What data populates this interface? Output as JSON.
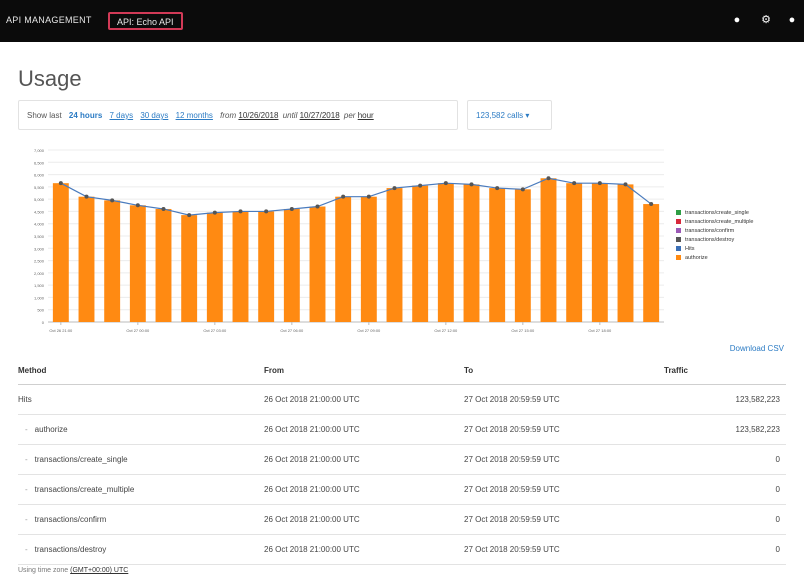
{
  "header": {
    "brand": "API MANAGEMENT",
    "api_chip": "API: Echo API",
    "icons": [
      "help-icon",
      "settings-icon",
      "user-icon"
    ]
  },
  "page": {
    "title": "Usage"
  },
  "filters": {
    "show_last": "Show last",
    "options": [
      "24 hours",
      "7 days",
      "30 days",
      "12 months"
    ],
    "active_option": "24 hours",
    "from_label": "from",
    "from_date": "10/26/2018",
    "until_label": "until",
    "until_date": "10/27/2018",
    "per_label": "per",
    "per_value": "hour",
    "metric_select": "123,582 calls"
  },
  "chart_data": {
    "type": "bar",
    "categories": [
      "Oct 26 21:00",
      "Oct 26 22:00",
      "Oct 26 23:00",
      "Oct 27 00:00",
      "Oct 27 01:00",
      "Oct 27 02:00",
      "Oct 27 03:00",
      "Oct 27 04:00",
      "Oct 27 05:00",
      "Oct 27 06:00",
      "Oct 27 07:00",
      "Oct 27 08:00",
      "Oct 27 09:00",
      "Oct 27 10:00",
      "Oct 27 11:00",
      "Oct 27 12:00",
      "Oct 27 13:00",
      "Oct 27 14:00",
      "Oct 27 15:00",
      "Oct 27 16:00",
      "Oct 27 17:00",
      "Oct 27 18:00",
      "Oct 27 19:00",
      "Oct 27 20:00"
    ],
    "tick_labels": [
      "Oct 26 21:00",
      "Oct 27 00:00",
      "Oct 27 03:00",
      "Oct 27 06:00",
      "Oct 27 09:00",
      "Oct 27 12:00",
      "Oct 27 15:00",
      "Oct 27 18:00"
    ],
    "y_ticks": [
      "0",
      "500",
      "1,000",
      "1,500",
      "2,000",
      "2,500",
      "3,000",
      "3,500",
      "4,000",
      "4,500",
      "5,000",
      "5,500",
      "6,000",
      "6,500",
      "7,000"
    ],
    "ylim": [
      0,
      7000
    ],
    "series": [
      {
        "name": "authorize",
        "color": "#ff8a12",
        "style": "bar",
        "values": [
          5650,
          5100,
          4950,
          4750,
          4600,
          4350,
          4450,
          4500,
          4500,
          4600,
          4700,
          5100,
          5100,
          5450,
          5550,
          5650,
          5600,
          5450,
          5400,
          5850,
          5650,
          5650,
          5600,
          4800
        ]
      },
      {
        "name": "Hits",
        "color": "#4a7bbd",
        "style": "line",
        "values": [
          5650,
          5100,
          4950,
          4750,
          4600,
          4350,
          4450,
          4500,
          4500,
          4600,
          4700,
          5100,
          5100,
          5450,
          5550,
          5650,
          5600,
          5450,
          5400,
          5850,
          5650,
          5650,
          5600,
          4800
        ]
      }
    ],
    "legend": [
      {
        "name": "transactions/create_single",
        "color": "#2e9e45"
      },
      {
        "name": "transactions/create_multiple",
        "color": "#d8283b"
      },
      {
        "name": "transactions/confirm",
        "color": "#9b59b6"
      },
      {
        "name": "transactions/destroy",
        "color": "#555555"
      },
      {
        "name": "Hits",
        "color": "#3b6fb6"
      },
      {
        "name": "authorize",
        "color": "#ff8a12"
      }
    ],
    "legend_position": "right",
    "grid": true
  },
  "download_label": "Download CSV",
  "table": {
    "headers": [
      "Method",
      "From",
      "To",
      "Traffic"
    ],
    "rows": [
      {
        "method": "Hits",
        "indent": false,
        "from": "26 Oct 2018 21:00:00 UTC",
        "to": "27 Oct 2018 20:59:59 UTC",
        "traffic": "123,582,223"
      },
      {
        "method": "authorize",
        "indent": true,
        "from": "26 Oct 2018 21:00:00 UTC",
        "to": "27 Oct 2018 20:59:59 UTC",
        "traffic": "123,582,223"
      },
      {
        "method": "transactions/create_single",
        "indent": true,
        "from": "26 Oct 2018 21:00:00 UTC",
        "to": "27 Oct 2018 20:59:59 UTC",
        "traffic": "0"
      },
      {
        "method": "transactions/create_multiple",
        "indent": true,
        "from": "26 Oct 2018 21:00:00 UTC",
        "to": "27 Oct 2018 20:59:59 UTC",
        "traffic": "0"
      },
      {
        "method": "transactions/confirm",
        "indent": true,
        "from": "26 Oct 2018 21:00:00 UTC",
        "to": "27 Oct 2018 20:59:59 UTC",
        "traffic": "0"
      },
      {
        "method": "transactions/destroy",
        "indent": true,
        "from": "26 Oct 2018 21:00:00 UTC",
        "to": "27 Oct 2018 20:59:59 UTC",
        "traffic": "0"
      }
    ]
  },
  "footer": {
    "tz_label": "Using time zone",
    "tz_value": "(GMT+00:00) UTC"
  }
}
